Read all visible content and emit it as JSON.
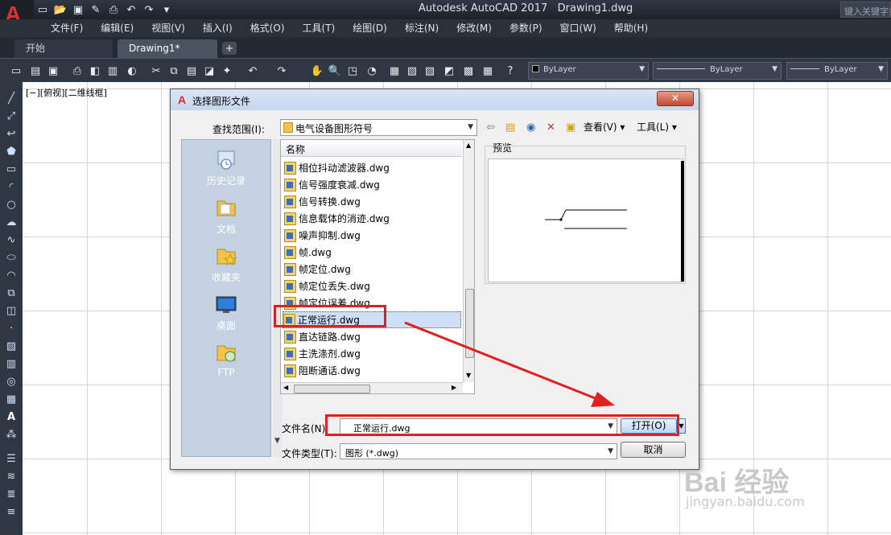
{
  "app": {
    "title": "Autodesk AutoCAD 2017",
    "document": "Drawing1.dwg",
    "logo": "A",
    "search_placeholder": "键入关键字或短语"
  },
  "menu": [
    "文件(F)",
    "编辑(E)",
    "视图(V)",
    "插入(I)",
    "格式(O)",
    "工具(T)",
    "绘图(D)",
    "标注(N)",
    "修改(M)",
    "参数(P)",
    "窗口(W)",
    "帮助(H)"
  ],
  "tabs": {
    "start": "开始",
    "drawing": "Drawing1*"
  },
  "properties": {
    "color": "ByLayer",
    "linetype": "ByLayer",
    "lineweight": "ByLayer"
  },
  "viewport_label": "[−][俯视][二维线框]",
  "dialog": {
    "title": "选择图形文件",
    "lookin_label": "查找范围(I):",
    "lookin_value": "电气设备图形符号",
    "views_label": "查看(V)",
    "tools_label": "工具(L)",
    "places": [
      "历史记录",
      "文档",
      "收藏夹",
      "桌面",
      "FTP"
    ],
    "list_header": "名称",
    "files": [
      "相位抖动滤波器.dwg",
      "信号强度衰减.dwg",
      "信号转换.dwg",
      "信息载体的消迹.dwg",
      "噪声抑制.dwg",
      "帧.dwg",
      "帧定位.dwg",
      "帧定位丢失.dwg",
      "帧定位误差.dwg",
      "正常运行.dwg",
      "直达链路.dwg",
      "主洗涤剂.dwg",
      "阻断通话.dwg"
    ],
    "selected_file": "正常运行.dwg",
    "preview_label": "预览",
    "filename_label": "文件名(N):",
    "filename_value": "正常运行.dwg",
    "filetype_label": "文件类型(T):",
    "filetype_value": "图形 (*.dwg)",
    "open_button": "打开(O)",
    "cancel_button": "取消"
  },
  "annotation_color": "#e02020",
  "watermark": {
    "main": "Bai 经验",
    "sub": "jingyan.baidu.com"
  }
}
